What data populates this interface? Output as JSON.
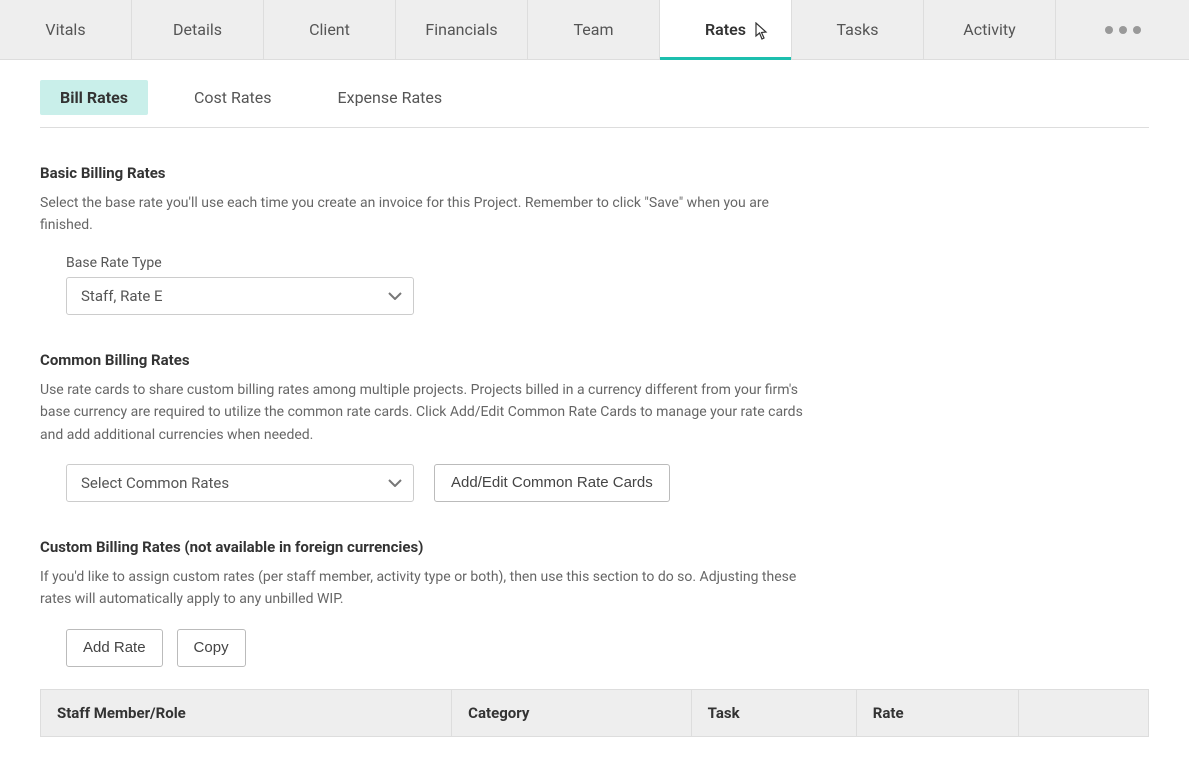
{
  "top_tabs": {
    "items": [
      "Vitals",
      "Details",
      "Client",
      "Financials",
      "Team",
      "Rates",
      "Tasks",
      "Activity"
    ],
    "active_index": 5
  },
  "sub_tabs": {
    "items": [
      "Bill Rates",
      "Cost Rates",
      "Expense Rates"
    ],
    "active_index": 0
  },
  "sections": {
    "basic": {
      "title": "Basic Billing Rates",
      "desc": "Select the base rate you'll use each time you create an invoice for this Project. Remember to click \"Save\" when you are finished.",
      "field_label": "Base Rate Type",
      "select_value": "Staff, Rate E"
    },
    "common": {
      "title": "Common Billing Rates",
      "desc": "Use rate cards to share custom billing rates among multiple projects. Projects billed in a currency different from your firm's base currency are required to utilize the common rate cards. Click Add/Edit Common Rate Cards to manage your rate cards and add additional currencies when needed.",
      "select_value": "Select Common Rates",
      "button_label": "Add/Edit Common Rate Cards"
    },
    "custom": {
      "title": "Custom Billing Rates (not available in foreign currencies)",
      "desc": "If you'd like to assign custom rates (per staff member, activity type or both), then use this section to do so. Adjusting these rates will automatically apply to any unbilled WIP.",
      "add_rate_label": "Add Rate",
      "copy_label": "Copy",
      "columns": [
        "Staff Member/Role",
        "Category",
        "Task",
        "Rate"
      ]
    }
  }
}
